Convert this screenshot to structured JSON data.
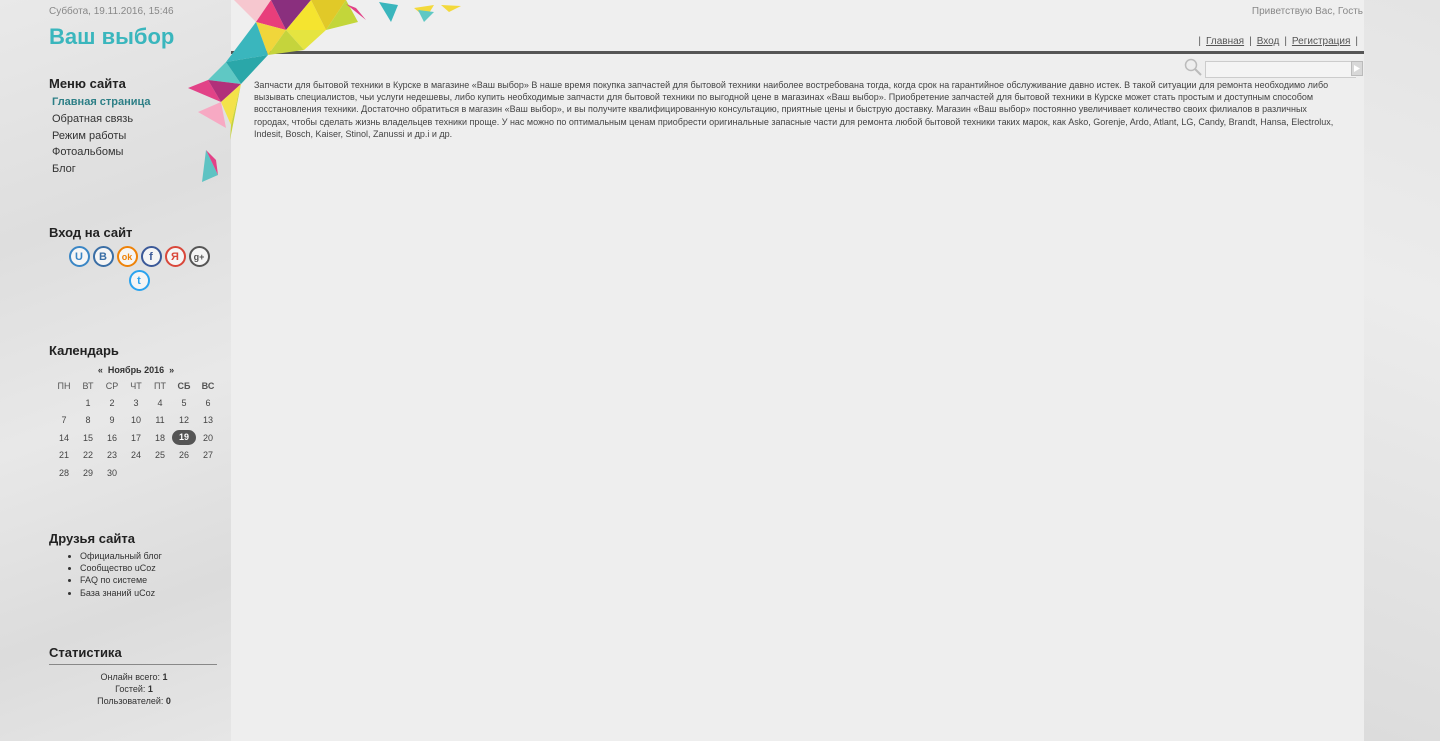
{
  "header": {
    "datetime": "Суббота, 19.11.2016, 15:46",
    "greeting": "Приветствую Вас, Гость",
    "site_title": "Ваш выбор",
    "nav": [
      "Главная",
      "Вход",
      "Регистрация"
    ]
  },
  "sidebar": {
    "menu_title": "Меню сайта",
    "menu_items": [
      {
        "label": "Главная страница",
        "active": true
      },
      {
        "label": "Обратная связь"
      },
      {
        "label": "Режим работы"
      },
      {
        "label": "Фотоальбомы"
      },
      {
        "label": "Блог"
      }
    ],
    "login_title": "Вход на сайт",
    "social": [
      {
        "icon": "ucoz-icon",
        "glyph": "U",
        "color": "#3a86c5"
      },
      {
        "icon": "vk-icon",
        "glyph": "B",
        "color": "#3a6ea5"
      },
      {
        "icon": "odnoklassniki-icon",
        "glyph": "ok",
        "color": "#ee8208"
      },
      {
        "icon": "facebook-icon",
        "glyph": "f",
        "color": "#3b5998"
      },
      {
        "icon": "yandex-icon",
        "glyph": "Я",
        "color": "#d9473a"
      },
      {
        "icon": "google-plus-icon",
        "glyph": "g+",
        "color": "#555555"
      },
      {
        "icon": "twitter-icon",
        "glyph": "t",
        "color": "#2aa3ef"
      }
    ],
    "calendar_title": "Календарь",
    "calendar": {
      "prev": "«",
      "month": "Ноябрь 2016",
      "next": "»",
      "weekdays": [
        "ПН",
        "ВТ",
        "СР",
        "ЧТ",
        "ПТ",
        "СБ",
        "ВС"
      ],
      "weeks": [
        [
          "",
          "1",
          "2",
          "3",
          "4",
          "5",
          "6"
        ],
        [
          "7",
          "8",
          "9",
          "10",
          "11",
          "12",
          "13"
        ],
        [
          "14",
          "15",
          "16",
          "17",
          "18",
          "19",
          "20"
        ],
        [
          "21",
          "22",
          "23",
          "24",
          "25",
          "26",
          "27"
        ],
        [
          "28",
          "29",
          "30",
          "",
          "",
          "",
          ""
        ]
      ],
      "today": "19"
    },
    "friends_title": "Друзья сайта",
    "friends": [
      "Официальный блог",
      "Сообщество uCoz",
      "FAQ по системе",
      "База знаний uCoz"
    ],
    "stats_title": "Статистика",
    "stats": {
      "online_label": "Онлайн всего:",
      "online_value": "1",
      "guests_label": "Гостей:",
      "guests_value": "1",
      "users_label": "Пользователей:",
      "users_value": "0"
    }
  },
  "main": {
    "text": "Запчасти для бытовой техники в Курске в магазине «Ваш выбор» В наше время покупка запчастей для бытовой техники наиболее востребована тогда, когда срок на гарантийное обслуживание давно истек. В такой ситуации для ремонта необходимо либо вызывать специалистов, чьи услуги недешевы, либо купить необходимые запчасти для бытовой техники по выгодной цене в магазинах «Ваш выбор». Приобретение запчастей для бытовой техники в Курске может стать простым и доступным способом восстановления техники. Достаточно обратиться в магазин «Ваш выбор», и вы получите квалифицированную консультацию, приятные цены и быструю доставку. Магазин «Ваш выбор» постоянно увеличивает количество своих филиалов в различных городах, чтобы сделать жизнь владельцев техники проще. У нас можно по оптимальным ценам приобрести оригинальные запасные части для ремонта любой бытовой техники таких марок, как Asko, Gorenje, Ardo, Atlant, LG, Candy, Brandt, Hansa, Electrolux, Indesit, Bosch, Kaiser, Stinol, Zanussi и др.і и др."
  },
  "colors": {
    "title": "#3ab6bd",
    "active_menu": "#2d7f86",
    "today_bg": "#555555"
  }
}
